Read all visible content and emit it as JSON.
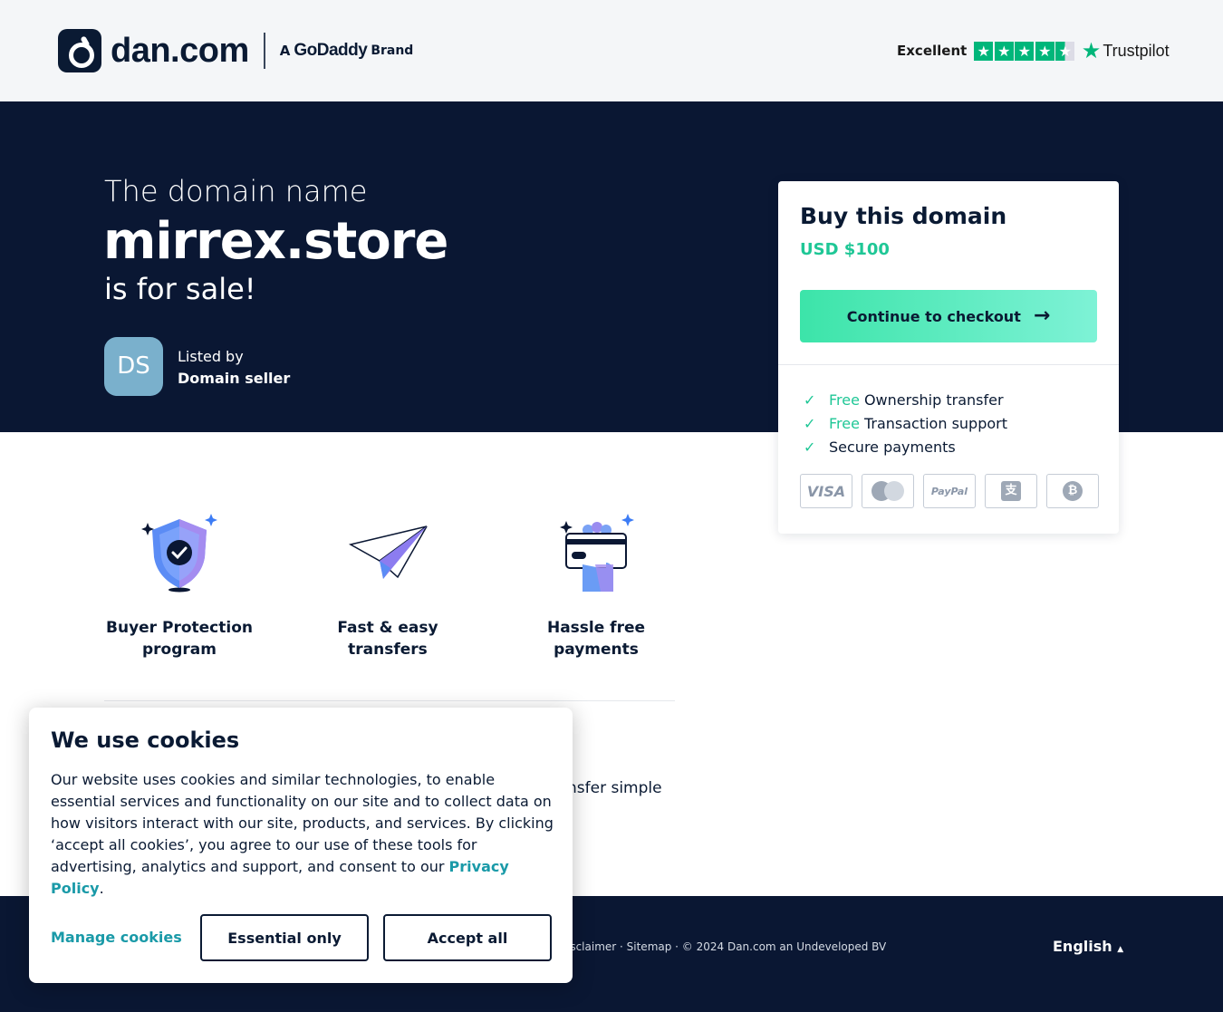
{
  "header": {
    "logo_text": "dan.com",
    "brand_prefix": "A",
    "brand_name": "GoDaddy",
    "brand_suffix": "Brand",
    "trustpilot_rating": "Excellent",
    "trustpilot_name": "Trustpilot",
    "trustpilot_stars": 4.5
  },
  "hero": {
    "pre_text": "The domain name",
    "domain": "mirrex.store",
    "post_text": "is for sale!",
    "seller_initials": "DS",
    "listed_by_label": "Listed by",
    "seller_name": "Domain seller"
  },
  "buy_card": {
    "title": "Buy this domain",
    "price": "USD $100",
    "checkout_label": "Continue to checkout",
    "features": [
      {
        "free": "Free",
        "text": "Ownership transfer"
      },
      {
        "free": "Free",
        "text": "Transaction support"
      },
      {
        "free": "",
        "text": "Secure payments"
      }
    ],
    "payment_methods": {
      "visa": "VISA",
      "paypal": "PayPal",
      "alipay": "支",
      "bitcoin": "₿"
    }
  },
  "benefits": [
    {
      "line1": "Buyer Protection",
      "line2": "program"
    },
    {
      "line1": "Fast & easy",
      "line2": "transfers"
    },
    {
      "line1": "Hassle free",
      "line2": "payments"
    }
  ],
  "partial_text": "nsfer simple",
  "footer": {
    "links": "isclaimer · Sitemap · © 2024 Dan.com an Undeveloped BV",
    "language": "English"
  },
  "cookies": {
    "title": "We use cookies",
    "body": "Our website uses cookies and similar technologies, to enable essential services and functionality on our site and to collect data on how visitors interact with our site, products, and services. By clicking ‘accept all cookies’, you agree to our use of these tools for advertising, analytics and support, and consent to our ",
    "privacy_link": "Privacy Policy",
    "body_end": ".",
    "manage_label": "Manage cookies",
    "essential_label": "Essential only",
    "accept_label": "Accept all"
  },
  "colors": {
    "navy": "#0a1733",
    "accent_green": "#1fc796",
    "link_teal": "#1a9aa8",
    "trustpilot_green": "#00b67a"
  }
}
